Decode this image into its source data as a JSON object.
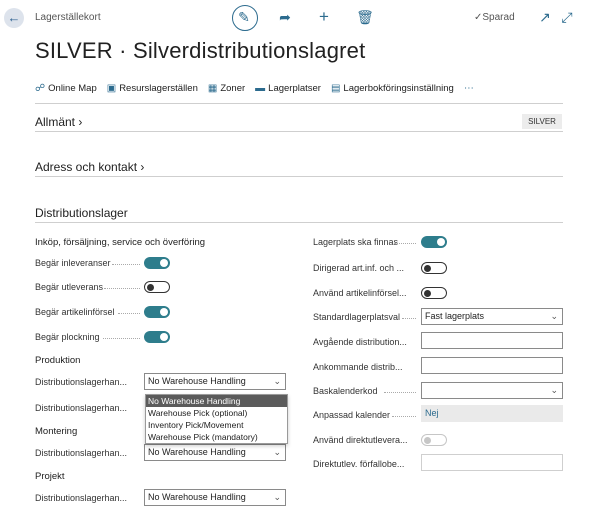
{
  "header": {
    "breadcrumb": "Lagerställekort",
    "saved_label": "Sparad",
    "page_title": "SILVER · Silverdistributionslagret"
  },
  "actions": [
    {
      "label": "Online Map",
      "icon": "map-icon"
    },
    {
      "label": "Resurslagerställen",
      "icon": "resource-location-icon"
    },
    {
      "label": "Zoner",
      "icon": "zones-icon"
    },
    {
      "label": "Lagerplatser",
      "icon": "bins-icon"
    },
    {
      "label": "Lagerbokföringsinställning",
      "icon": "inventory-posting-icon"
    }
  ],
  "sections": {
    "general": {
      "title": "Allmänt",
      "badge": "SILVER"
    },
    "address": {
      "title": "Adress och kontakt"
    },
    "warehouse": {
      "title": "Distributionslager"
    }
  },
  "left": {
    "group1_title": "Inköp, försäljning, service och överföring",
    "require_receive": {
      "label": "Begär inleveranser",
      "on": true
    },
    "require_shipment": {
      "label": "Begär utleverans",
      "on": false
    },
    "require_put_away": {
      "label": "Begär artikelinförsel",
      "on": true
    },
    "require_pick": {
      "label": "Begär plockning",
      "on": true
    },
    "production_title": "Produktion",
    "prod_handling_1": {
      "label": "Distributionslagerhan...",
      "value": "No Warehouse Handling"
    },
    "prod_handling_2": {
      "label": "Distributionslagerhan..."
    },
    "assembly_title": "Montering",
    "asm_handling": {
      "label": "Distributionslagerhan...",
      "value": "No Warehouse Handling"
    },
    "project_title": "Projekt",
    "proj_handling": {
      "label": "Distributionslagerhan...",
      "value": "No Warehouse Handling"
    }
  },
  "dropdown_options": [
    "No Warehouse Handling",
    "Warehouse Pick (optional)",
    "Inventory Pick/Movement",
    "Warehouse Pick (mandatory)"
  ],
  "right": {
    "bin_mandatory": {
      "label": "Lagerplats ska finnas",
      "on": true
    },
    "directed_putaway": {
      "label": "Dirigerad art.inf. och ...",
      "on": false
    },
    "use_put_away_worksheet": {
      "label": "Använd artikelinförsel...",
      "on": false
    },
    "default_bin_selection": {
      "label": "Standardlagerplatsval",
      "value": "Fast lagerplats"
    },
    "outbound_bin": {
      "label": "Avgående distribution...",
      "value": ""
    },
    "inbound_bin": {
      "label": "Ankommande distrib...",
      "value": ""
    },
    "base_calendar": {
      "label": "Baskalenderkod",
      "value": ""
    },
    "custom_calendar": {
      "label": "Anpassad kalender",
      "value": "Nej"
    },
    "use_cross_dock": {
      "label": "Använd direktutlevera...",
      "on": false
    },
    "cross_dock_due_date": {
      "label": "Direktutlev. förfallobe...",
      "value": ""
    }
  },
  "colors": {
    "accent": "#2c6b8e",
    "toggle_on": "#2e7d8c"
  }
}
